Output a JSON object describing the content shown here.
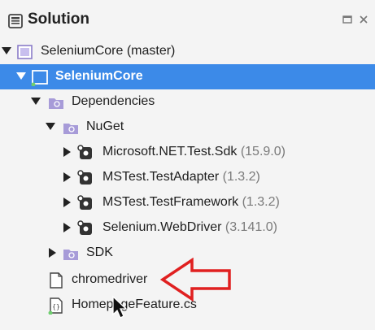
{
  "panel": {
    "title": "Solution",
    "icon": "solution-panel-icon",
    "controls": [
      "restore-icon",
      "close-icon"
    ]
  },
  "tree": {
    "solution": {
      "label": "SeleniumCore (master)",
      "icon": "solution-icon",
      "expanded": true
    },
    "project": {
      "label": "SeleniumCore",
      "icon": "project-icon",
      "expanded": true,
      "selected": true
    },
    "dependencies": {
      "label": "Dependencies",
      "icon": "folder-icon",
      "expanded": true
    },
    "nuget": {
      "label": "NuGet",
      "icon": "folder-icon",
      "expanded": true
    },
    "packages": [
      {
        "name": "Microsoft.NET.Test.Sdk",
        "version": "(15.9.0)",
        "icon": "package-icon"
      },
      {
        "name": "MSTest.TestAdapter",
        "version": "(1.3.2)",
        "icon": "package-icon"
      },
      {
        "name": "MSTest.TestFramework",
        "version": "(1.3.2)",
        "icon": "package-icon"
      },
      {
        "name": "Selenium.WebDriver",
        "version": "(3.141.0)",
        "icon": "package-icon"
      }
    ],
    "sdk": {
      "label": "SDK",
      "icon": "folder-icon",
      "expanded": false
    },
    "files": [
      {
        "label": "chromedriver",
        "icon": "file-icon"
      },
      {
        "label": "HomepageFeature.cs",
        "icon": "csharp-file-icon"
      }
    ]
  },
  "colors": {
    "selection": "#3c8ae8",
    "annotation_arrow": "#e02020",
    "folder": "#a79bd8",
    "version_text": "#7a7a7a"
  }
}
